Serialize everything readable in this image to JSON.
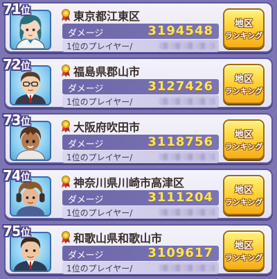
{
  "rows": [
    {
      "rank": "71",
      "rank_suffix": "位",
      "area": "東京都江東区",
      "damage_label": "ダメージ",
      "damage": "3194548",
      "player_label": "1位のプレイヤー/",
      "button_line1": "地区",
      "button_line2": "ランキング",
      "avatar": "girl-teal-hair-avatar"
    },
    {
      "rank": "72",
      "rank_suffix": "位",
      "area": "福島県郡山市",
      "damage_label": "ダメージ",
      "damage": "3127426",
      "player_label": "1位のプレイヤー/",
      "button_line1": "地区",
      "button_line2": "ランキング",
      "avatar": "man-glasses-avatar"
    },
    {
      "rank": "73",
      "rank_suffix": "位",
      "area": "大阪府吹田市",
      "damage_label": "ダメージ",
      "damage": "3118756",
      "player_label": "1位のプレイヤー/",
      "button_line1": "地区",
      "button_line2": "ランキング",
      "avatar": "boy-brown-hair-avatar"
    },
    {
      "rank": "74",
      "rank_suffix": "位",
      "area": "神奈川県川崎市高津区",
      "damage_label": "ダメージ",
      "damage": "3111204",
      "player_label": "1位のプレイヤー/",
      "button_line1": "地区",
      "button_line2": "ランキング",
      "avatar": "boy-headphones-avatar"
    },
    {
      "rank": "75",
      "rank_suffix": "位",
      "area": "和歌山県和歌山市",
      "damage_label": "ダメージ",
      "damage": "3109617",
      "player_label": "1位のプレイヤー/",
      "button_line1": "地区",
      "button_line2": "ランキング",
      "avatar": "man-suit-avatar"
    }
  ],
  "colors": {
    "background": "#7d74b4",
    "card_border": "#5d56a0",
    "damage_value": "#ffe45a",
    "button_gold": "#ffd43a"
  }
}
